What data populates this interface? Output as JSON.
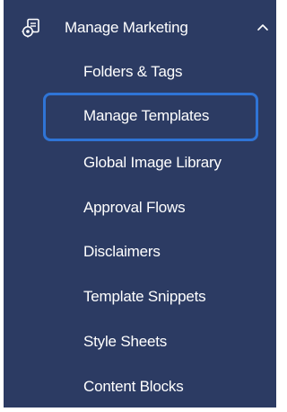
{
  "section": {
    "title": "Manage Marketing",
    "icon": "marketing-settings-icon",
    "expanded": true
  },
  "menu": {
    "items": [
      {
        "label": "Folders & Tags",
        "selected": false
      },
      {
        "label": "Manage Templates",
        "selected": true
      },
      {
        "label": "Global Image Library",
        "selected": false
      },
      {
        "label": "Approval Flows",
        "selected": false
      },
      {
        "label": "Disclaimers",
        "selected": false
      },
      {
        "label": "Template Snippets",
        "selected": false
      },
      {
        "label": "Style Sheets",
        "selected": false
      },
      {
        "label": "Content Blocks",
        "selected": false
      }
    ]
  },
  "colors": {
    "background": "#2c3b63",
    "text": "#ffffff",
    "selection_border": "#2f74d6"
  }
}
